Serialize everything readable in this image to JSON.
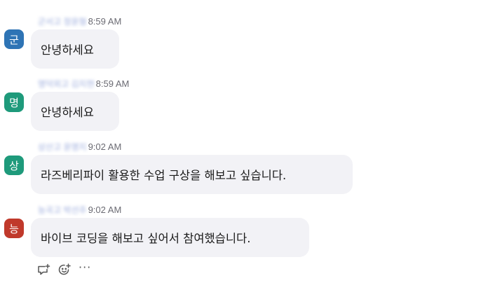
{
  "messages": [
    {
      "sender": "군서고 정윤형",
      "time": "8:59 AM",
      "avatar": "군",
      "avatar_color": "#2e74b5",
      "text": "안녕하세요"
    },
    {
      "sender": "명덕외고 김지현",
      "time": "8:59 AM",
      "avatar": "명",
      "avatar_color": "#1e9a7b",
      "text": "안녕하세요"
    },
    {
      "sender": "상산고 윤명지",
      "time": "9:02 AM",
      "avatar": "상",
      "avatar_color": "#1e9a7b",
      "text": "라즈베리파이 활용한 수업 구상을 해보고 싶습니다."
    },
    {
      "sender": "능곡고 박선주",
      "time": "9:02 AM",
      "avatar": "능",
      "avatar_color": "#c0392b",
      "text": "바이브 코딩을 해보고 싶어서 참여했습니다."
    }
  ],
  "actions": {
    "reply_icon": "reply-thread-icon",
    "emoji_icon": "add-reaction-icon",
    "more_label": "···"
  }
}
